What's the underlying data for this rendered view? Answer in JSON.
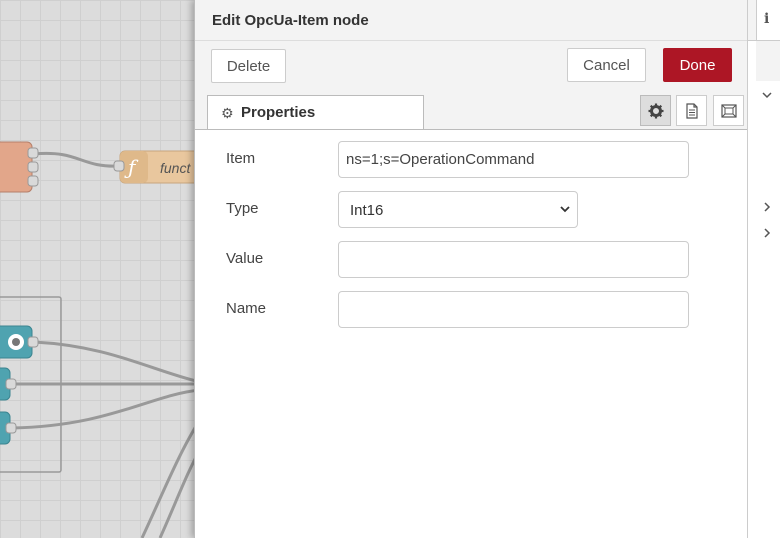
{
  "canvas": {
    "function_node_label": "funct"
  },
  "tray": {
    "title": "Edit OpcUa-Item node",
    "buttons": {
      "delete": "Delete",
      "cancel": "Cancel",
      "done": "Done"
    },
    "tabs": {
      "properties": "Properties"
    }
  },
  "form": {
    "item": {
      "label": "Item",
      "value": "ns=1;s=OperationCommand"
    },
    "type": {
      "label": "Type",
      "value": "Int16"
    },
    "value": {
      "label": "Value",
      "value": ""
    },
    "name": {
      "label": "Name",
      "value": ""
    }
  },
  "sidebar": {
    "info_tab_icon": "i"
  },
  "colors": {
    "done_button": "#ad1625",
    "node_orange": "#e2a68a",
    "node_teal": "#4fa3b0",
    "node_function": "#e9c79e"
  }
}
